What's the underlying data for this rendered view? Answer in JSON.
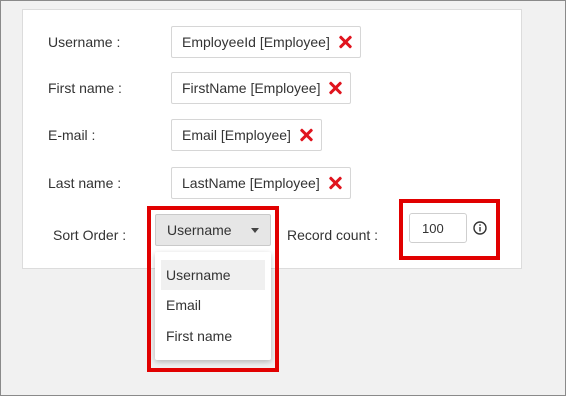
{
  "form": {
    "fields": [
      {
        "label": "Username :",
        "value": "EmployeeId [Employee]"
      },
      {
        "label": "First name :",
        "value": "FirstName [Employee]"
      },
      {
        "label": "E-mail :",
        "value": "Email [Employee]"
      },
      {
        "label": "Last name :",
        "value": "LastName [Employee]"
      }
    ],
    "sort_order": {
      "label": "Sort Order :",
      "selected": "Username",
      "options": [
        "Username",
        "Email",
        "First name"
      ]
    },
    "record_count": {
      "label": "Record count :",
      "value": "100"
    }
  },
  "colors": {
    "highlight": "#e10000",
    "remove_icon": "#e0141e"
  },
  "icons": {
    "remove": "close-x-icon",
    "dropdown": "caret-down-icon",
    "info": "info-circle-icon"
  }
}
